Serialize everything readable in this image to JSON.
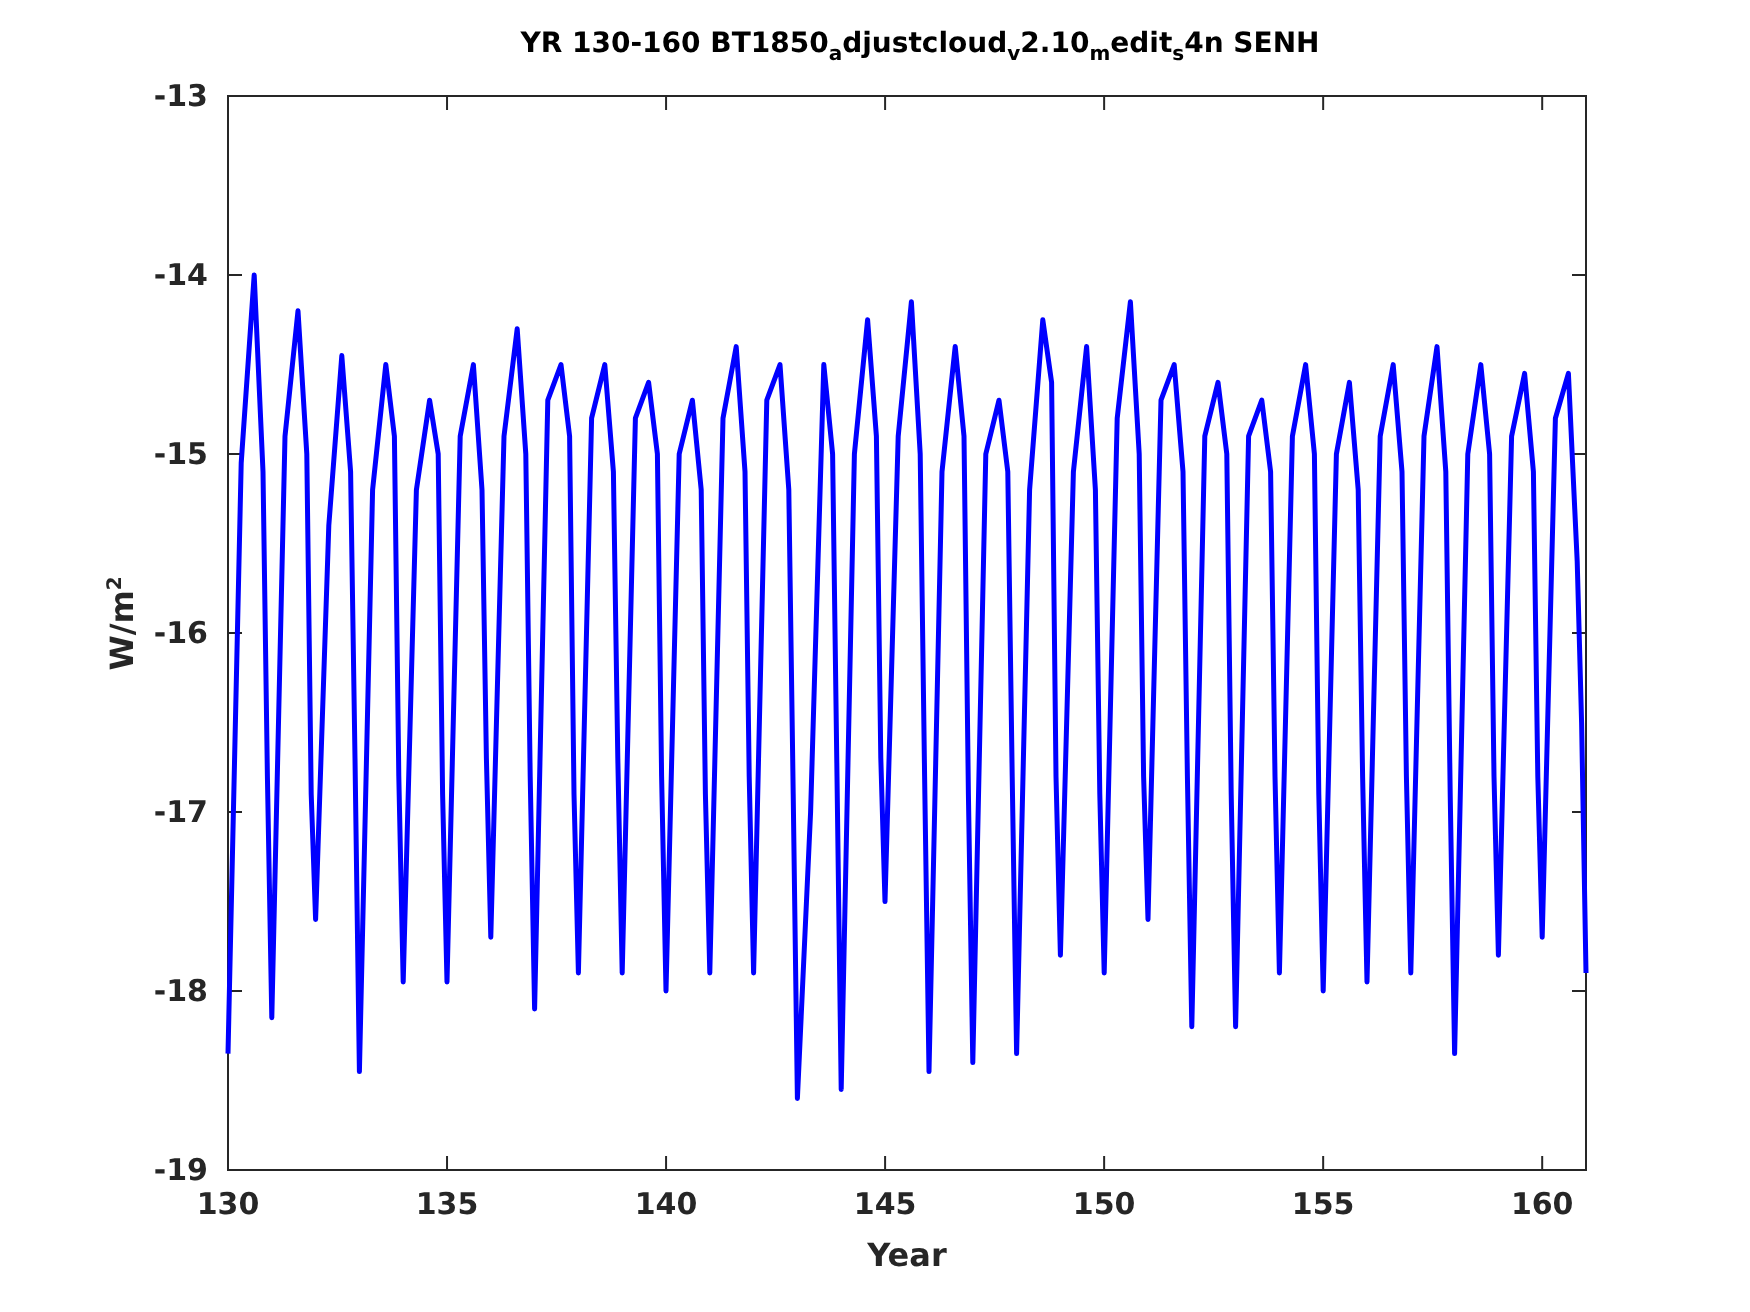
{
  "chart_data": {
    "type": "line",
    "title": "YR 130-160 BT1850$_{a}$djustcloud$_{v}$2.10$_{m}$edit$_{s}$4n SENH",
    "xlabel": "Year",
    "ylabel": "W/m$^{2}$",
    "xlim": [
      130,
      161
    ],
    "ylim": [
      -19,
      -13
    ],
    "xticks": [
      130,
      135,
      140,
      145,
      150,
      155,
      160
    ],
    "yticks": [
      -19,
      -18,
      -17,
      -16,
      -15,
      -14,
      -13
    ],
    "x": [
      130,
      130.3,
      130.6,
      130.8,
      130.9,
      131,
      131.3,
      131.6,
      131.8,
      131.9,
      132,
      132.3,
      132.6,
      132.8,
      132.9,
      133,
      133.3,
      133.6,
      133.8,
      133.9,
      134,
      134.3,
      134.6,
      134.8,
      134.9,
      135,
      135.3,
      135.6,
      135.8,
      135.9,
      136,
      136.3,
      136.6,
      136.8,
      136.9,
      137,
      137.3,
      137.6,
      137.8,
      137.9,
      138,
      138.3,
      138.6,
      138.8,
      138.9,
      139,
      139.3,
      139.6,
      139.8,
      139.9,
      140,
      140.3,
      140.6,
      140.8,
      140.9,
      141,
      141.3,
      141.6,
      141.8,
      141.9,
      142,
      142.3,
      142.6,
      142.8,
      142.9,
      143,
      143.3,
      143.6,
      143.8,
      143.9,
      144,
      144.3,
      144.6,
      144.8,
      144.9,
      145,
      145.3,
      145.6,
      145.8,
      145.9,
      146,
      146.3,
      146.6,
      146.8,
      146.9,
      147,
      147.3,
      147.6,
      147.8,
      147.9,
      148,
      148.3,
      148.6,
      148.8,
      148.9,
      149,
      149.3,
      149.6,
      149.8,
      149.9,
      150,
      150.3,
      150.6,
      150.8,
      150.9,
      151,
      151.3,
      151.6,
      151.8,
      151.9,
      152,
      152.3,
      152.6,
      152.8,
      152.9,
      153,
      153.3,
      153.6,
      153.8,
      153.9,
      154,
      154.3,
      154.6,
      154.8,
      154.9,
      155,
      155.3,
      155.6,
      155.8,
      155.9,
      156,
      156.3,
      156.6,
      156.8,
      156.9,
      157,
      157.3,
      157.6,
      157.8,
      157.9,
      158,
      158.3,
      158.6,
      158.8,
      158.9,
      159,
      159.3,
      159.6,
      159.8,
      159.9,
      160,
      160.3,
      160.6,
      160.8,
      160.9,
      161
    ],
    "series": [
      {
        "color": "#0000ff",
        "values": [
          -18.35,
          -15.05,
          -14.0,
          -15.1,
          -16.8,
          -18.15,
          -14.9,
          -14.2,
          -15.0,
          -16.9,
          -17.6,
          -15.4,
          -14.45,
          -15.1,
          -16.7,
          -18.45,
          -15.2,
          -14.5,
          -14.9,
          -16.8,
          -17.95,
          -15.2,
          -14.7,
          -15.0,
          -16.9,
          -17.95,
          -14.9,
          -14.5,
          -15.2,
          -16.7,
          -17.7,
          -14.9,
          -14.3,
          -15.0,
          -16.8,
          -18.1,
          -14.7,
          -14.5,
          -14.9,
          -16.9,
          -17.9,
          -14.8,
          -14.5,
          -15.1,
          -16.7,
          -17.9,
          -14.8,
          -14.6,
          -15.0,
          -16.8,
          -18.0,
          -15.0,
          -14.7,
          -15.2,
          -16.9,
          -17.9,
          -14.8,
          -14.4,
          -15.1,
          -16.8,
          -17.9,
          -14.7,
          -14.5,
          -15.2,
          -16.9,
          -18.6,
          -17.0,
          -14.5,
          -15.0,
          -16.8,
          -18.55,
          -15.0,
          -14.25,
          -14.9,
          -16.7,
          -17.5,
          -14.9,
          -14.15,
          -15.0,
          -16.8,
          -18.45,
          -15.1,
          -14.4,
          -14.9,
          -16.9,
          -18.4,
          -15.0,
          -14.7,
          -15.1,
          -16.8,
          -18.35,
          -15.2,
          -14.25,
          -14.6,
          -16.8,
          -17.8,
          -15.1,
          -14.4,
          -15.2,
          -16.9,
          -17.9,
          -14.8,
          -14.15,
          -15.0,
          -16.8,
          -17.6,
          -14.7,
          -14.5,
          -15.1,
          -16.8,
          -18.2,
          -14.9,
          -14.6,
          -15.0,
          -16.9,
          -18.2,
          -14.9,
          -14.7,
          -15.1,
          -16.8,
          -17.9,
          -14.9,
          -14.5,
          -15.0,
          -16.9,
          -18.0,
          -15.0,
          -14.6,
          -15.2,
          -16.8,
          -17.95,
          -14.9,
          -14.5,
          -15.1,
          -16.8,
          -17.9,
          -14.9,
          -14.4,
          -15.1,
          -16.9,
          -18.35,
          -15.0,
          -14.5,
          -15.0,
          -16.8,
          -17.8,
          -14.9,
          -14.55,
          -15.1,
          -16.8,
          -17.7,
          -14.8,
          -14.55,
          -15.6,
          -16.5,
          -17.9
        ]
      }
    ]
  }
}
